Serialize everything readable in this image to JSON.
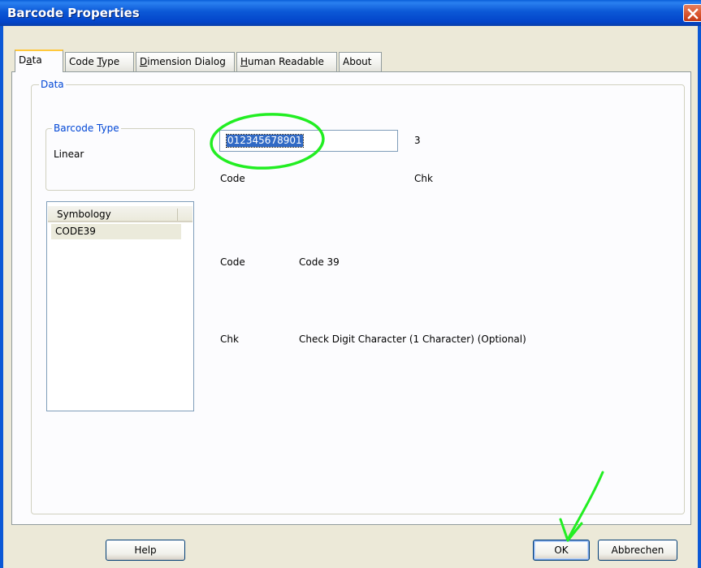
{
  "window": {
    "title": "Barcode Properties"
  },
  "tabs": [
    {
      "pre": "D",
      "acc": "a",
      "post": "ta",
      "active": true
    },
    {
      "pre": "Code ",
      "acc": "T",
      "post": "ype"
    },
    {
      "pre": "",
      "acc": "D",
      "post": "imension Dialog"
    },
    {
      "pre": "",
      "acc": "H",
      "post": "uman Readable"
    },
    {
      "pre": "About",
      "acc": "",
      "post": ""
    }
  ],
  "data_group": {
    "label": "Data"
  },
  "barcode_type": {
    "label": "Barcode Type",
    "value": "Linear"
  },
  "symbology": {
    "header": "Symbology",
    "rows": [
      "CODE39"
    ]
  },
  "code_input": {
    "value": "012345678901",
    "check_value": "3",
    "code_label": "Code",
    "chk_label": "Chk"
  },
  "legend": [
    {
      "key": "Code",
      "desc": "Code 39"
    },
    {
      "key": "Chk",
      "desc": "Check Digit Character (1 Character) (Optional)"
    }
  ],
  "buttons": {
    "help": "Help",
    "ok": "OK",
    "cancel": "Abbrechen"
  },
  "colors": {
    "title_bar": "#0b58d6",
    "annotation": "#22ee22",
    "selection": "#316ac5"
  }
}
